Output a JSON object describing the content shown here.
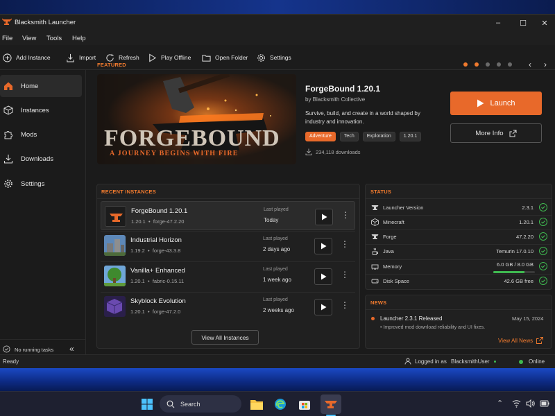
{
  "window": {
    "title": "Blacksmith Launcher",
    "minimize": "–",
    "maximize": "☐",
    "close": "✕"
  },
  "menu": [
    "File",
    "View",
    "Tools",
    "Help"
  ],
  "toolbar": {
    "add_instance": "Add Instance",
    "import": "Import",
    "refresh": "Refresh",
    "play_offline": "Play Offline",
    "open_folder": "Open Folder",
    "settings": "Settings"
  },
  "sidebar": {
    "items": [
      {
        "label": "Home",
        "icon": "home-icon",
        "active": true
      },
      {
        "label": "Instances",
        "icon": "cube-icon",
        "active": false
      },
      {
        "label": "Mods",
        "icon": "puzzle-icon",
        "active": false
      },
      {
        "label": "Downloads",
        "icon": "download-icon",
        "active": false
      },
      {
        "label": "Settings",
        "icon": "gear-icon",
        "active": false
      }
    ],
    "footer": "No running tasks",
    "collapse": "«"
  },
  "featured": {
    "header": "FEATURED",
    "banner_title": "FORGEBOUND",
    "banner_subtitle": "A JOURNEY BEGINS WITH FIRE",
    "title": "ForgeBound 1.20.1",
    "author": "by Blacksmith Collective",
    "description": "Survive, build, and create in a world shaped by industry and innovation.",
    "tags": [
      "Adventure",
      "Tech",
      "Exploration",
      "1.20.1"
    ],
    "downloads": "234,118 downloads",
    "launch": "Launch",
    "more_info": "More Info",
    "carousel_prev": "‹",
    "carousel_next": "›"
  },
  "recent": {
    "header": "RECENT INSTANCES",
    "last_played_label": "Last played",
    "instances": [
      {
        "name": "ForgeBound 1.20.1",
        "version": "1.20.1",
        "loader": "forge-47.2.20",
        "last_played": "Today"
      },
      {
        "name": "Industrial Horizon",
        "version": "1.19.2",
        "loader": "forge-43.3.8",
        "last_played": "2 days ago"
      },
      {
        "name": "Vanilla+ Enhanced",
        "version": "1.20.1",
        "loader": "fabric-0.15.11",
        "last_played": "1 week ago"
      },
      {
        "name": "Skyblock Evolution",
        "version": "1.20.1",
        "loader": "forge-47.2.0",
        "last_played": "2 weeks ago"
      }
    ],
    "bullet": "•",
    "view_all": "View All Instances"
  },
  "status": {
    "header": "STATUS",
    "rows": [
      {
        "label": "Launcher Version",
        "value": "2.3.1",
        "icon": "launcher-icon"
      },
      {
        "label": "Minecraft",
        "value": "1.20.1",
        "icon": "cube-icon"
      },
      {
        "label": "Forge",
        "value": "47.2.20",
        "icon": "anvil-icon"
      },
      {
        "label": "Java",
        "value": "Temurin 17.0.10",
        "icon": "java-icon"
      },
      {
        "label": "Memory",
        "value": "6.0 GB / 8.0 GB",
        "icon": "memory-icon"
      },
      {
        "label": "Disk Space",
        "value": "42.6 GB free",
        "icon": "disk-icon"
      }
    ],
    "memory_fraction": 0.75,
    "ok_color": "#3fb950"
  },
  "news": {
    "header": "NEWS",
    "items": [
      {
        "title": "Launcher 2.3.1 Released",
        "date": "May 15, 2024",
        "summary": "• Improved mod download reliability and UI fixes."
      }
    ],
    "view_all": "View All News"
  },
  "statusbar": {
    "left": "Ready",
    "logged_in": "Logged in as",
    "user": "BlacksmithUser",
    "online": "Online"
  },
  "taskbar": {
    "search": "Search"
  },
  "colors": {
    "accent": "#e8692a",
    "ok": "#3fb950"
  }
}
